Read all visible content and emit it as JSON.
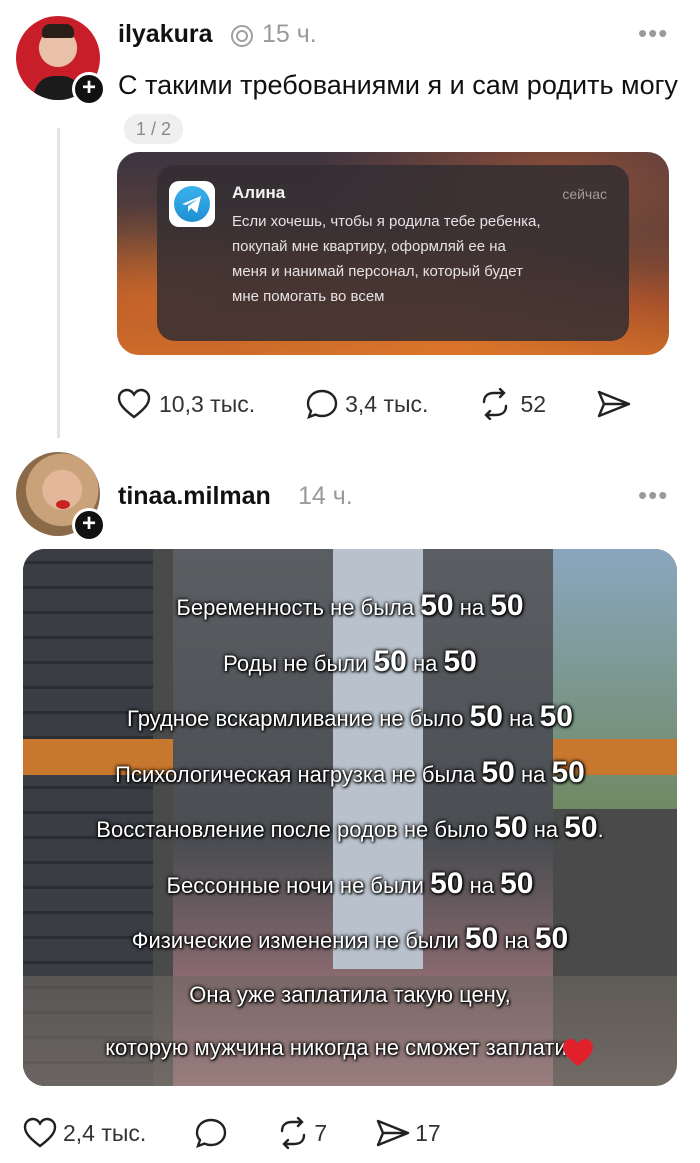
{
  "posts": [
    {
      "username": "ilyakura",
      "time": "15 ч.",
      "text": "С такими требованиями я и сам родить могу",
      "page_indicator": "1 / 2",
      "notification": {
        "sender": "Алина",
        "time": "сейчас",
        "message": "Если хочешь, чтобы я родила тебе ребенка, покупай мне квартиру, оформляй ее на меня и нанимай персонал, который будет мне помогать во всем"
      },
      "likes": "10,3 тыс.",
      "comments": "3,4 тыс.",
      "reposts": "52",
      "shares": ""
    },
    {
      "username": "tinaa.milman",
      "time": "14 ч.",
      "overlay_lines": [
        {
          "pre": "Беременность не была ",
          "num1": "50",
          "mid": " на ",
          "num2": "50",
          "post": ""
        },
        {
          "pre": "Роды не были ",
          "num1": "50",
          "mid": " на ",
          "num2": "50",
          "post": ""
        },
        {
          "pre": "Грудное вскармливание не было ",
          "num1": "50",
          "mid": " на ",
          "num2": "50",
          "post": ""
        },
        {
          "pre": "Психологическая нагрузка не была ",
          "num1": "50",
          "mid": " на ",
          "num2": "50",
          "post": ""
        },
        {
          "pre": "Восстановление после родов не было ",
          "num1": "50",
          "mid": " на ",
          "num2": "50",
          "post": "."
        },
        {
          "pre": "Бессонные ночи не были ",
          "num1": "50",
          "mid": " на ",
          "num2": "50",
          "post": ""
        },
        {
          "pre": "Физические изменения не были ",
          "num1": "50",
          "mid": " на ",
          "num2": "50",
          "post": ""
        },
        {
          "pre": "Она уже заплатила такую цену,",
          "num1": "",
          "mid": "",
          "num2": "",
          "post": ""
        },
        {
          "pre": "которую мужчина никогда не сможет заплати",
          "num1": "",
          "mid": "",
          "num2": "",
          "post": ""
        }
      ],
      "likes": "2,4 тыс.",
      "comments": "",
      "reposts": "7",
      "shares": "17"
    }
  ],
  "icons": {
    "more": "more-icon",
    "like": "heart-icon",
    "comment": "comment-icon",
    "repost": "repost-icon",
    "share": "share-icon",
    "verified": "badge-icon",
    "telegram": "telegram-icon",
    "follow": "plus-icon"
  },
  "colors": {
    "text": "#111111",
    "muted": "#9a9a9a",
    "heart_emoji": "#e0202a",
    "telegram_blue": "#2a9ce0"
  }
}
